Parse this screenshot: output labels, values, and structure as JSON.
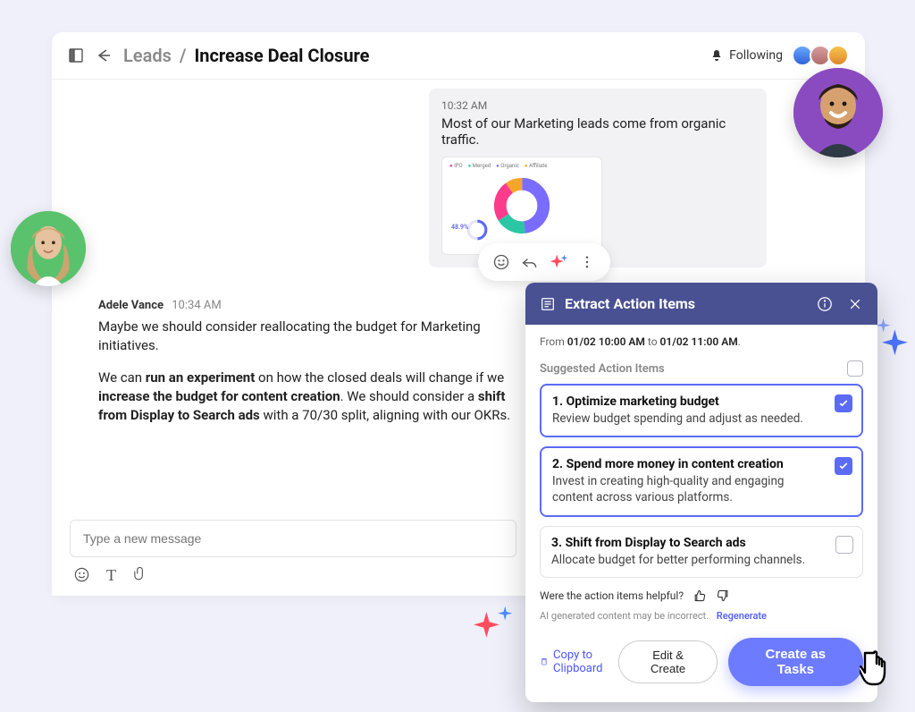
{
  "header": {
    "breadcrumb_parent": "Leads",
    "breadcrumb_title": "Increase Deal Closure",
    "following_label": "Following"
  },
  "messages": {
    "top": {
      "time": "10:32 AM",
      "text": "Most of our Marketing leads come from organic traffic."
    },
    "adele": {
      "sender": "Adele Vance",
      "time": "10:34 AM",
      "p1a": "Maybe we should consider reallocating the budget for Marketing initiatives.",
      "p2a": "We can ",
      "p2b": "run an experiment",
      "p2c": " on how the closed deals will change if we ",
      "p2d": "increase the budget for content creation",
      "p2e": ". We should consider a ",
      "p2f": "shift from Display to Search ads",
      "p2g": " with a 70/30 split, aligning with our OKRs."
    }
  },
  "chart": {
    "percent_label": "48.9%",
    "legend": {
      "l1": "IPO",
      "l2": "Merged",
      "l3": "Organic",
      "l4": "Affiliate"
    }
  },
  "composer": {
    "placeholder": "Type a new message"
  },
  "extract_panel": {
    "title": "Extract Action Items",
    "from_prefix": "From ",
    "from_start": "01/02 10:00 AM",
    "from_mid": " to ",
    "from_end": "01/02 11:00 AM",
    "from_suffix": ".",
    "subheading": "Suggested Action Items",
    "items": [
      {
        "num": "1.",
        "title": "Optimize marketing budget",
        "desc": "Review budget spending and adjust as needed.",
        "selected": true
      },
      {
        "num": "2.",
        "title": "Spend more money in content creation",
        "desc": "Invest in creating high-quality and engaging content across various platforms.",
        "selected": true
      },
      {
        "num": "3.",
        "title": "Shift from Display to Search ads",
        "desc": "Allocate budget for better performing channels.",
        "selected": false
      }
    ],
    "feedback_q": "Were the action items helpful?",
    "disclaimer": "AI generated content may be incorrect.",
    "regenerate": "Regenerate",
    "copy": "Copy to Clipboard",
    "edit_create": "Edit & Create",
    "create_tasks": "Create as Tasks"
  }
}
